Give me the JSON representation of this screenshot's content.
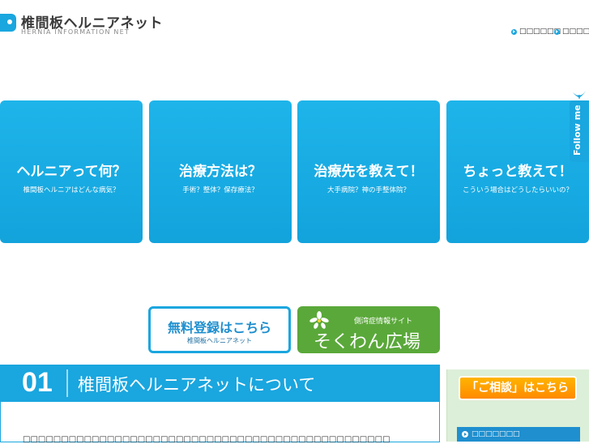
{
  "header": {
    "site_name": "椎間板ヘルニアネット",
    "site_name_en": "HERNIA INFORMATION NET",
    "links": [
      "□□□□□□",
      "□□□□□□"
    ]
  },
  "tiles": [
    {
      "title": "ヘルニアって何？",
      "subtitle": "椎間板ヘルニアはどんな病気？"
    },
    {
      "title": "治療方法は？",
      "subtitle": "手術？整体？保存療法？"
    },
    {
      "title": "治療先を教えて！",
      "subtitle": "大手病院？神の手整体院？"
    },
    {
      "title": "ちょっと教えて！",
      "subtitle": "こういう場合はどうしたらいいの？"
    }
  ],
  "follow": {
    "label": "Follow me"
  },
  "banners": {
    "register": {
      "title": "無料登録はこちら",
      "subtitle": "椎間板ヘルニアネット"
    },
    "sokuwan": {
      "subtitle": "側湾症情報サイト",
      "title": "そくわん広場"
    }
  },
  "section": {
    "number": "01",
    "title": "椎間板ヘルニアネットについて",
    "text": "□□□□□□□□□□□□□□□□□□□□□□□□□□□□□□□□□□□□□□□□□□□□□□□□"
  },
  "sidebar": {
    "consult_label": "「ご相談」はこちら",
    "link_label": "□□□□□□□"
  },
  "colors": {
    "accent": "#1aa6df",
    "green": "#5aa83a",
    "orange": "#ff9a00"
  }
}
